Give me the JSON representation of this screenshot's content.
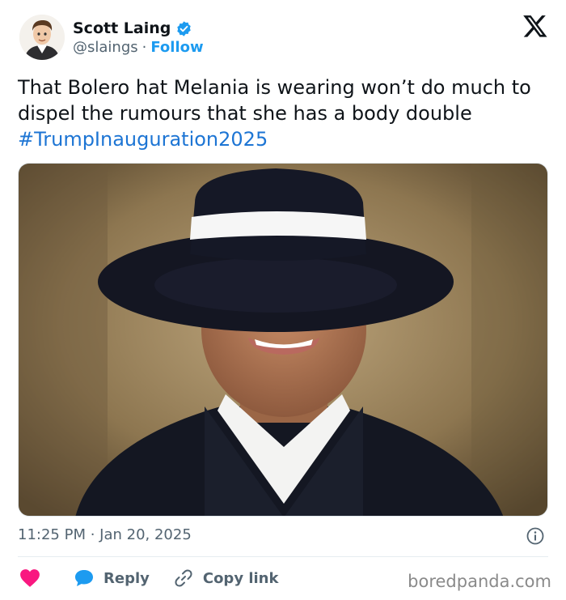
{
  "author": {
    "name": "Scott Laing",
    "handle": "@slaings",
    "separator": "·",
    "follow_label": "Follow",
    "verified_icon": "verified-badge-icon",
    "avatar_icon": "avatar"
  },
  "tweet": {
    "text": "That Bolero hat Melania is wearing won’t do much to dispel the rumours that she has a body double",
    "hashtag": "#TrumpInauguration2025"
  },
  "meta": {
    "timestamp": "11:25 PM · Jan 20, 2025"
  },
  "actions": {
    "reply_label": "Reply",
    "copy_label": "Copy link"
  },
  "watermark": "boredpanda.com",
  "colors": {
    "accent": "#1d9bf0",
    "hashtag": "#1d75d4",
    "like": "#f91880",
    "reply_bubble": "#1d9bf0",
    "muted": "#536471"
  }
}
